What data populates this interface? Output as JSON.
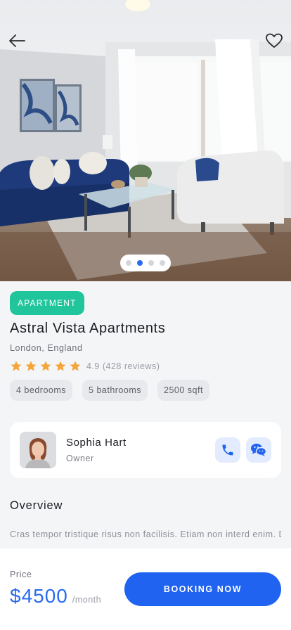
{
  "hero": {
    "carousel": {
      "total": 4,
      "active_index": 1
    }
  },
  "property": {
    "type_badge": "APARTMENT",
    "title": "Astral Vista Apartments",
    "location": "London, England",
    "rating": {
      "stars": 5,
      "text": "4.9 (428 reviews)"
    },
    "features": [
      "4 bedrooms",
      "5 bathrooms",
      "2500 sqft"
    ]
  },
  "owner": {
    "name": "Sophia Hart",
    "role": "Owner"
  },
  "overview": {
    "title": "Overview",
    "text": "Cras tempor tristique risus non facilisis. Etiam non interd enim. Duis semper nibh et massa aliquet placerat house"
  },
  "footer": {
    "price_label": "Price",
    "price": "$4500",
    "price_unit": "/month",
    "book_label": "BOOKING NOW"
  },
  "colors": {
    "accent": "#1f63f0",
    "badge": "#20c59b",
    "star": "#f5a63b"
  }
}
